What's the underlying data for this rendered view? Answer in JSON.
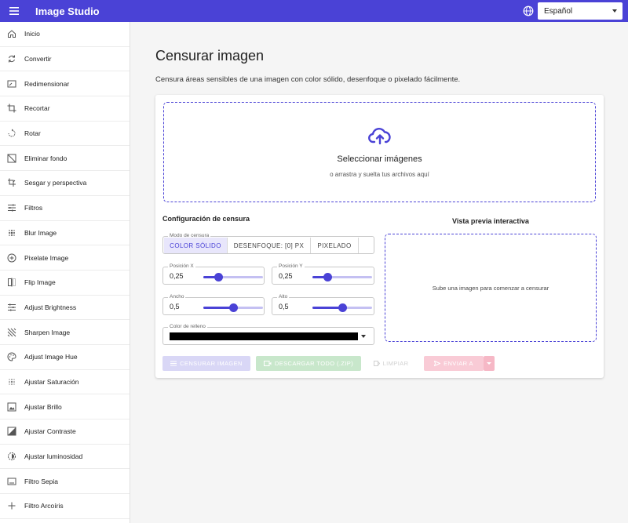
{
  "app": {
    "title": "Image Studio"
  },
  "language": {
    "selected": "Español"
  },
  "sidebar": {
    "items": [
      {
        "label": "Inicio",
        "icon": "home-icon"
      },
      {
        "label": "Convertir",
        "icon": "refresh-icon"
      },
      {
        "label": "Redimensionar",
        "icon": "resize-icon"
      },
      {
        "label": "Recortar",
        "icon": "crop-icon"
      },
      {
        "label": "Rotar",
        "icon": "rotate-icon"
      },
      {
        "label": "Eliminar fondo",
        "icon": "remove-background-icon"
      },
      {
        "label": "Sesgar y perspectiva",
        "icon": "perspective-icon"
      },
      {
        "label": "Filtros",
        "icon": "tune-icon"
      },
      {
        "label": "Blur Image",
        "icon": "blur-icon"
      },
      {
        "label": "Pixelate Image",
        "icon": "pixelate-icon"
      },
      {
        "label": "Flip Image",
        "icon": "flip-icon"
      },
      {
        "label": "Adjust Brightness",
        "icon": "brightness-icon"
      },
      {
        "label": "Sharpen Image",
        "icon": "sharpen-icon"
      },
      {
        "label": "Adjust Image Hue",
        "icon": "palette-icon"
      },
      {
        "label": "Ajustar Saturación",
        "icon": "saturation-icon"
      },
      {
        "label": "Ajustar Brillo",
        "icon": "brightness-image-icon"
      },
      {
        "label": "Ajustar Contraste",
        "icon": "contrast-icon"
      },
      {
        "label": "Ajustar luminosidad",
        "icon": "luminosity-icon"
      },
      {
        "label": "Filtro Sepia",
        "icon": "sepia-icon"
      },
      {
        "label": "Filtro Arcoíris",
        "icon": "plus-icon"
      }
    ]
  },
  "page": {
    "title": "Censurar imagen",
    "description": "Censura áreas sensibles de una imagen con color sólido, desenfoque o pixelado fácilmente."
  },
  "dropzone": {
    "title": "Seleccionar imágenes",
    "subtitle": "o arrastra y suelta tus archivos aquí"
  },
  "config": {
    "title": "Configuración de censura",
    "mode": {
      "label": "Modo de censura",
      "options": [
        "COLOR SÓLIDO",
        "DESENFOQUE: [0] PX",
        "PIXELADO"
      ],
      "selected": "COLOR SÓLIDO"
    },
    "position_x": {
      "label": "Posición X",
      "value": "0,25",
      "level": 0.25
    },
    "position_y": {
      "label": "Posición Y",
      "value": "0,25",
      "level": 0.25
    },
    "width": {
      "label": "Ancho",
      "value": "0,5",
      "level": 0.5
    },
    "height": {
      "label": "Alto",
      "value": "0,5",
      "level": 0.5
    },
    "fill_color": {
      "label": "Color de relleno",
      "value": "#000000"
    }
  },
  "preview": {
    "title": "Vista previa interactiva",
    "placeholder": "Sube una imagen para comenzar a censurar"
  },
  "actions": {
    "censor": "CENSURAR IMAGEN",
    "download": "DESCARGAR TODO (.ZIP)",
    "clear": "LIMPIAR",
    "send": "ENVIAR A"
  },
  "colors": {
    "primary": "#4a42d6",
    "download_disabled": "#c8e7cb",
    "send_disabled": "#f9cbd6"
  }
}
